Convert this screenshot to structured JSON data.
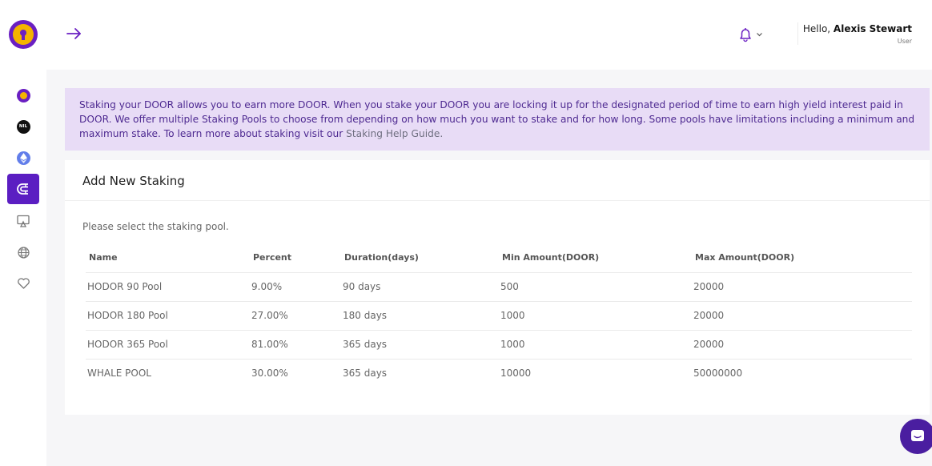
{
  "header": {
    "greeting_prefix": "Hello, ",
    "user_name": "Alexis Stewart",
    "user_role": "User"
  },
  "sidebar": {
    "items": [
      {
        "name": "door-coin",
        "icon": "door-coin-icon"
      },
      {
        "name": "nil-coin",
        "icon": "nil-coin-icon",
        "label": "NIL"
      },
      {
        "name": "eth-coin",
        "icon": "eth-coin-icon"
      },
      {
        "name": "staking",
        "icon": "magnet-icon",
        "active": true
      },
      {
        "name": "presentation",
        "icon": "presentation-icon"
      },
      {
        "name": "globe",
        "icon": "globe-icon"
      },
      {
        "name": "favorites",
        "icon": "heart-icon"
      }
    ]
  },
  "banner": {
    "text": "Staking your DOOR allows you to earn more DOOR. When you stake your DOOR you are locking it up for the designated period of time to earn high yield interest paid in DOOR. We offer multiple Staking Pools to choose from depending on how much you want to stake and for how long. Some pools have limitations including a minimum and maximum stake. To learn more about staking visit our ",
    "link_text": "Staking Help Guide."
  },
  "staking": {
    "title": "Add New Staking",
    "subtitle": "Please select the staking pool.",
    "columns": [
      "Name",
      "Percent",
      "Duration(days)",
      "Min Amount(DOOR)",
      "Max Amount(DOOR)"
    ],
    "rows": [
      [
        "HODOR 90 Pool",
        "9.00%",
        "90 days",
        "500",
        "20000"
      ],
      [
        "HODOR 180 Pool",
        "27.00%",
        "180 days",
        "1000",
        "20000"
      ],
      [
        "HODOR 365 Pool",
        "81.00%",
        "365 days",
        "1000",
        "20000"
      ],
      [
        "WHALE POOL",
        "30.00%",
        "365 days",
        "10000",
        "50000000"
      ]
    ]
  },
  "colors": {
    "brand_purple": "#5b1ec2",
    "brand_gold": "#f4b400",
    "banner_bg": "#e8dcf6"
  }
}
